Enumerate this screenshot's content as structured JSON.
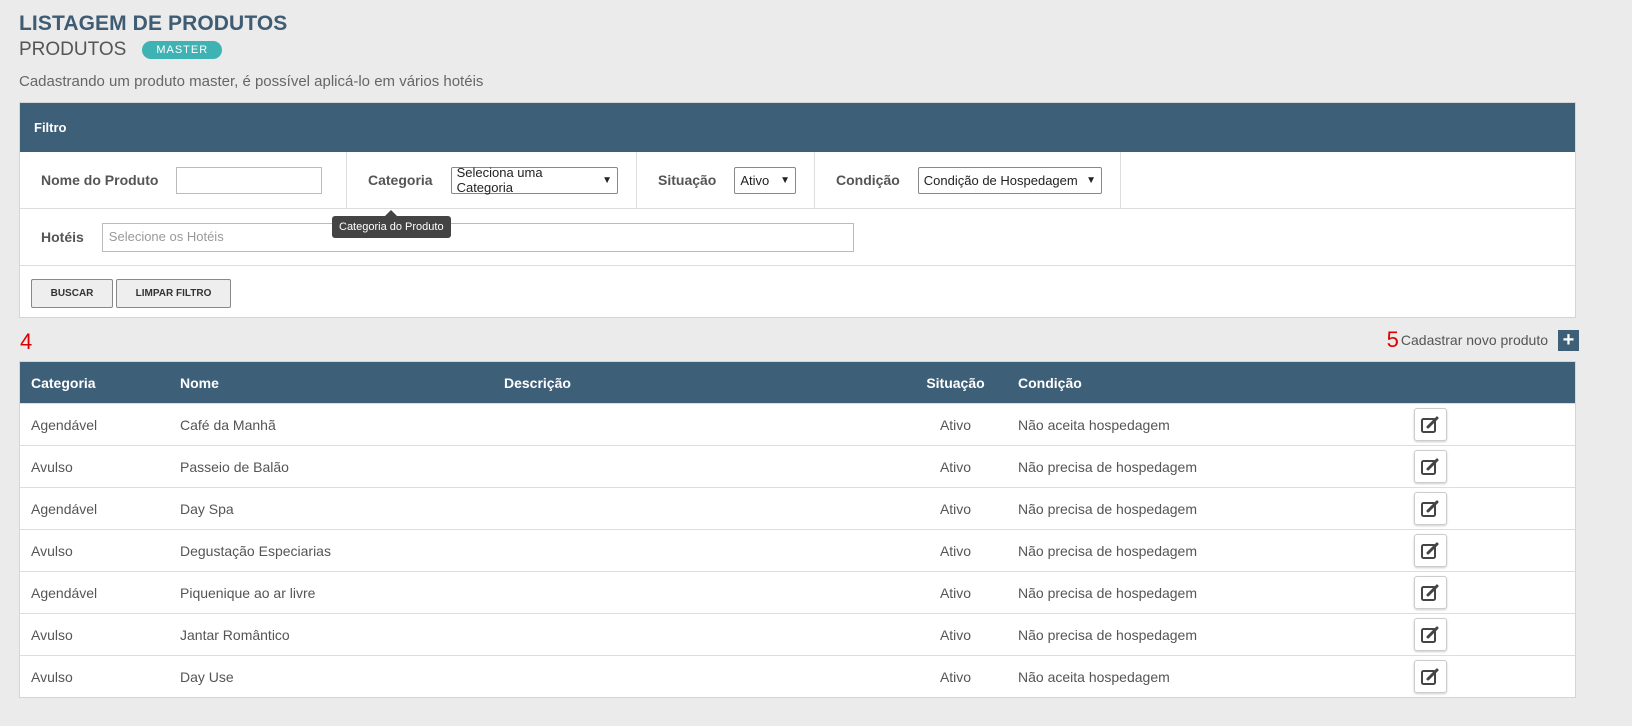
{
  "header": {
    "title": "LISTAGEM DE PRODUTOS",
    "subtitle": "PRODUTOS",
    "badge": "MASTER",
    "description": "Cadastrando um produto master, é possível aplicá-lo em vários hotéis"
  },
  "filter": {
    "heading": "Filtro",
    "nome_label": "Nome do Produto",
    "nome_value": "",
    "categoria_label": "Categoria",
    "categoria_selected": "Seleciona uma Categoria",
    "situacao_label": "Situação",
    "situacao_selected": "Ativo",
    "condicao_label": "Condição",
    "condicao_selected": "Condição de Hospedagem",
    "hoteis_label": "Hotéis",
    "hoteis_placeholder": "Selecione os Hotéis",
    "tooltip": "Categoria do Produto",
    "buscar_label": "BUSCAR",
    "limpar_label": "LIMPAR FILTRO"
  },
  "list": {
    "count_annotation": "4",
    "new_annotation": "5",
    "new_label": "Cadastrar novo produto",
    "columns": [
      "Categoria",
      "Nome",
      "Descrição",
      "Situação",
      "Condição"
    ],
    "rows": [
      {
        "categoria": "Agendável",
        "nome": "Café da Manhã",
        "descricao": "",
        "situacao": "Ativo",
        "condicao": "Não aceita hospedagem"
      },
      {
        "categoria": "Avulso",
        "nome": "Passeio de Balão",
        "descricao": "",
        "situacao": "Ativo",
        "condicao": "Não precisa de hospedagem"
      },
      {
        "categoria": "Agendável",
        "nome": "Day Spa",
        "descricao": "",
        "situacao": "Ativo",
        "condicao": "Não precisa de hospedagem"
      },
      {
        "categoria": "Avulso",
        "nome": "Degustação Especiarias",
        "descricao": "",
        "situacao": "Ativo",
        "condicao": "Não precisa de hospedagem"
      },
      {
        "categoria": "Agendável",
        "nome": "Piquenique ao ar livre",
        "descricao": "",
        "situacao": "Ativo",
        "condicao": "Não precisa de hospedagem"
      },
      {
        "categoria": "Avulso",
        "nome": "Jantar Romântico",
        "descricao": "",
        "situacao": "Ativo",
        "condicao": "Não precisa de hospedagem"
      },
      {
        "categoria": "Avulso",
        "nome": "Day Use",
        "descricao": "",
        "situacao": "Ativo",
        "condicao": "Não aceita hospedagem"
      }
    ]
  },
  "colors": {
    "header_bg": "#3e5f78",
    "badge": "#3fb2b4",
    "annotation": "#dd0000"
  },
  "icons": {
    "edit": "edit-icon",
    "add": "plus-icon"
  }
}
